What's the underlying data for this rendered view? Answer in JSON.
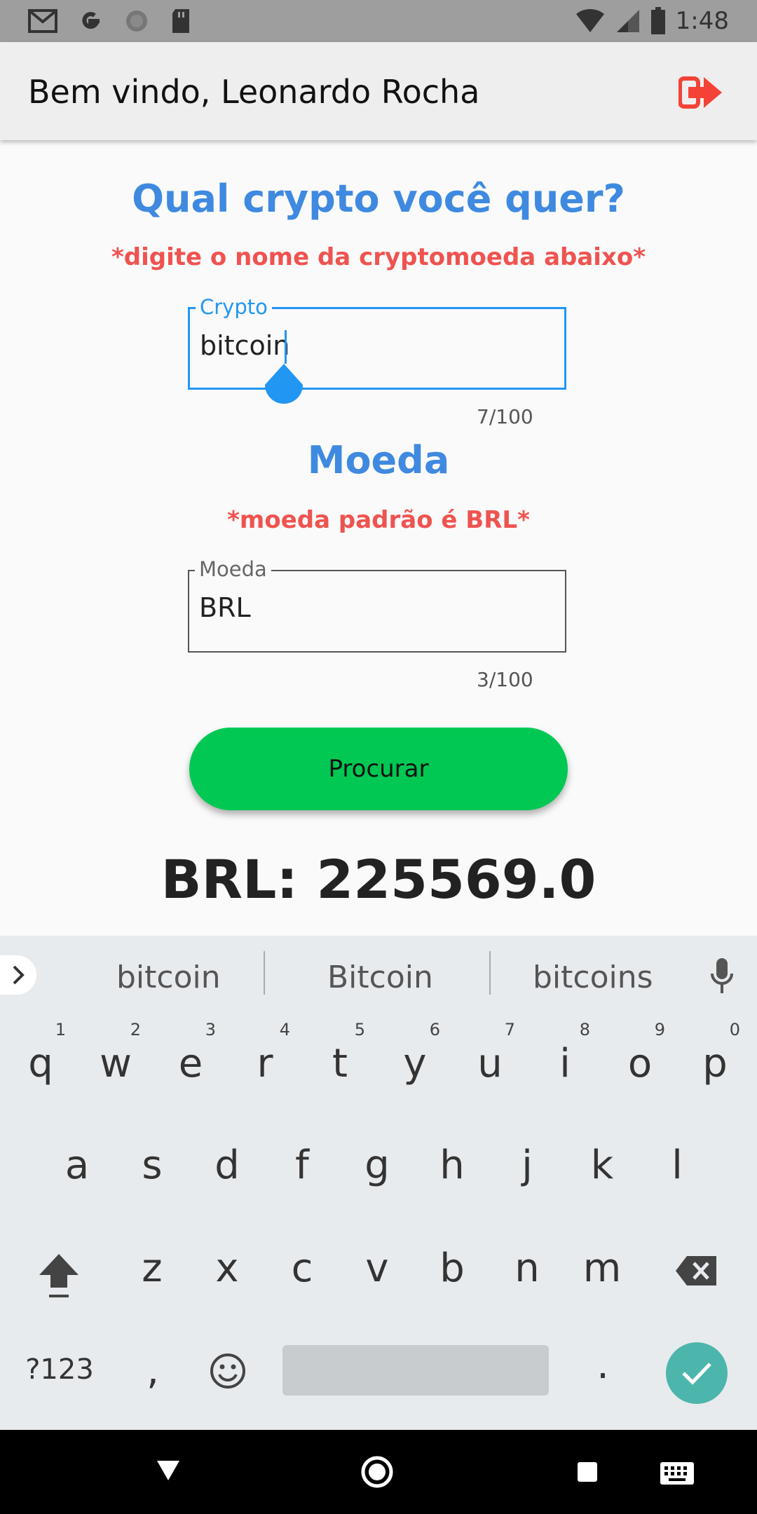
{
  "status_bar": {
    "time": "1:48",
    "left_icons": [
      "gmail-icon",
      "google-icon",
      "sync-icon",
      "sd-card-icon"
    ],
    "right_icons": [
      "wifi-icon",
      "cell-signal-icon",
      "battery-icon"
    ]
  },
  "app_bar": {
    "title": "Bem vindo, Leonardo Rocha",
    "logout_icon": "logout-icon",
    "logout_color": "#f44336"
  },
  "main": {
    "crypto_title": "Qual crypto você quer?",
    "crypto_hint": "*digite o nome da cryptomoeda abaixo*",
    "crypto_field": {
      "label": "Crypto",
      "value": "bitcoin",
      "counter": "7/100"
    },
    "currency_title": "Moeda",
    "currency_hint": "*moeda padrão é BRL*",
    "currency_field": {
      "label": "Moeda",
      "value": "BRL",
      "counter": "3/100"
    },
    "search_button": "Procurar",
    "result": "BRL: 225569.0"
  },
  "keyboard": {
    "suggestions": [
      "bitcoin",
      "Bitcoin",
      "bitcoins"
    ],
    "row1": [
      "q",
      "w",
      "e",
      "r",
      "t",
      "y",
      "u",
      "i",
      "o",
      "p"
    ],
    "row1_hints": [
      "1",
      "2",
      "3",
      "4",
      "5",
      "6",
      "7",
      "8",
      "9",
      "0"
    ],
    "row2": [
      "a",
      "s",
      "d",
      "f",
      "g",
      "h",
      "j",
      "k",
      "l"
    ],
    "row3": [
      "z",
      "x",
      "c",
      "v",
      "b",
      "n",
      "m"
    ],
    "symbols_key": "?123",
    "comma_key": ",",
    "period_key": "."
  },
  "colors": {
    "title_blue": "#3f8ae0",
    "hint_red": "#ef5350",
    "focus_blue": "#2196f3",
    "button_green": "#00c853",
    "enter_teal": "#4db6ac"
  }
}
